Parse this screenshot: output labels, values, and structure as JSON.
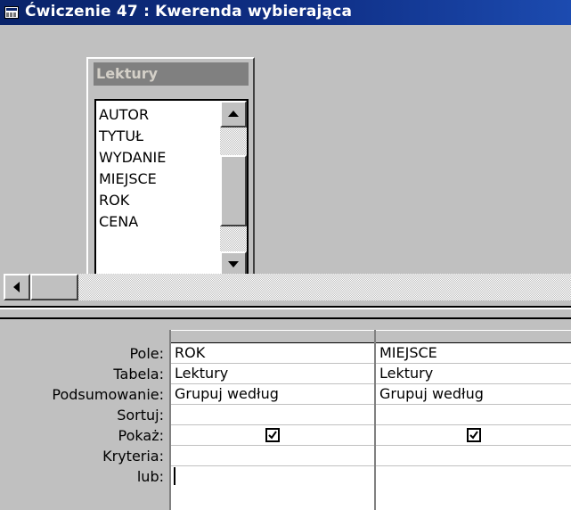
{
  "window": {
    "title": "Ćwiczenie 47 : Kwerenda wybierająca"
  },
  "table": {
    "name": "Lektury",
    "fields": [
      "AUTOR",
      "TYTUŁ",
      "WYDANIE",
      "MIEJSCE",
      "ROK",
      "CENA"
    ]
  },
  "grid": {
    "row_labels": [
      "Pole:",
      "Tabela:",
      "Podsumowanie:",
      "Sortuj:",
      "Pokaż:",
      "Kryteria:",
      "lub:"
    ],
    "columns": [
      {
        "pole": "ROK",
        "tabela": "Lektury",
        "podsumowanie": "Grupuj według",
        "sortuj": "",
        "pokaz": true,
        "kryteria": "",
        "lub": ""
      },
      {
        "pole": "MIEJSCE",
        "tabela": "Lektury",
        "podsumowanie": "Grupuj według",
        "sortuj": "",
        "pokaz": true,
        "kryteria": "",
        "lub": ""
      }
    ]
  },
  "colors": {
    "titlebar": "#0a246a",
    "face": "#c0c0c0"
  }
}
